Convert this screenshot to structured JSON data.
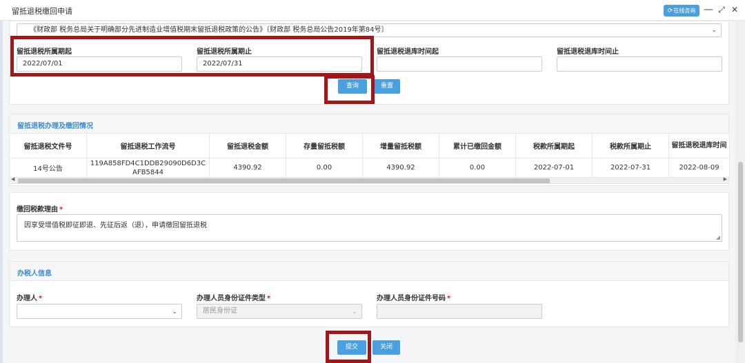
{
  "window": {
    "title": "留抵退税缴回申请",
    "online_button": "在线咨询",
    "minimize": "—",
    "maximize": "⤢",
    "close": "✕"
  },
  "policy_select": {
    "value": "《财政部 税务总局关于明确部分先进制造业增值税期末留抵退税政策的公告》〔财政部 税务总局公告2019年第84号〕"
  },
  "filters": {
    "period_start_label": "留抵退税所属期起",
    "period_start_value": "2022/07/01",
    "period_end_label": "留抵退税所属期止",
    "period_end_value": "2022/07/31",
    "refund_start_label": "留抵退税退库时间起",
    "refund_start_value": "",
    "refund_end_label": "留抵退税退库时间止",
    "refund_end_value": "",
    "query_button": "查询",
    "reset_button": "重置"
  },
  "handling": {
    "title": "留抵退税办理及缴回情况",
    "columns": [
      "留抵退税文件号",
      "留抵退税工作流号",
      "留抵退税金额",
      "存量留抵税额",
      "增量留抵税额",
      "累计已缴回金额",
      "税款所属期起",
      "税款所属期止",
      "留抵退税退库时间"
    ],
    "rows": [
      [
        "14号公告",
        "119A858FD4C1DDB29090D6D3CAFB5844",
        "4390.92",
        "0.00",
        "4390.92",
        "0.00",
        "2022-07-01",
        "2022-07-31",
        "2022-08-09"
      ]
    ]
  },
  "reason": {
    "label": "缴回税款理由",
    "value": "因享受增值税即征即退、先征后返（退），申请缴回留抵退税"
  },
  "agent": {
    "title": "办税人信息",
    "handler_label": "办理人",
    "handler_value": "",
    "id_type_label": "办理人员身份证件类型",
    "id_type_value": "居民身份证",
    "id_number_label": "办理人员身份证件号码",
    "id_number_value": ""
  },
  "actions": {
    "submit_button": "提交",
    "close_button": "关闭"
  },
  "colors": {
    "accent": "#4a9fe0",
    "section_title": "#3a8bd2",
    "highlight_box": "#a0161b",
    "required": "#e02020"
  }
}
